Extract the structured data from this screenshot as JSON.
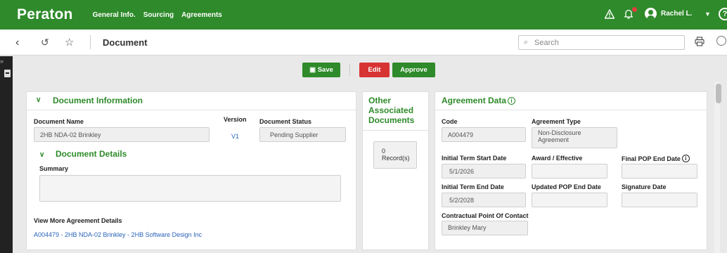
{
  "app": {
    "brand": "Peraton",
    "nav": [
      "General Info.",
      "Sourcing",
      "Agreements"
    ],
    "user_name": "Rachel L."
  },
  "subbar": {
    "page_title": "Document",
    "search_placeholder": "Search"
  },
  "actions": {
    "save": "Save",
    "edit": "Edit",
    "approve": "Approve"
  },
  "document_information": {
    "header": "Document Information",
    "name_label": "Document Name",
    "name_value": "2HB NDA-02 Brinkley",
    "version_label": "Version",
    "version_value": "V1",
    "status_label": "Document Status",
    "status_value": "Pending Supplier",
    "details_header": "Document Details",
    "summary_label": "Summary",
    "more_label": "View More Agreement Details",
    "more_link": "A004479 - 2HB NDA-02 Brinkley - 2HB Software Design Inc"
  },
  "other_documents": {
    "header_line1": "Other",
    "header_line2": "Associated",
    "header_line3": "Documents",
    "count": "0",
    "count_label": "Record(s)"
  },
  "agreement_data": {
    "header": "Agreement Data",
    "code_label": "Code",
    "code_value": "A004479",
    "type_label": "Agreement Type",
    "type_value_line1": "Non-Disclosure",
    "type_value_line2": "Agreement",
    "start_label": "Initial Term Start Date",
    "start_value": "5/1/2026",
    "award_label": "Award / Effective",
    "final_pop_label": "Final POP End Date",
    "end_label": "Initial Term End Date",
    "end_value": "5/2/2028",
    "updated_pop_label": "Updated POP End Date",
    "signature_label": "Signature Date",
    "contact_label": "Contractual Point Of Contact",
    "contact_value": "Brinkley Mary"
  },
  "colors": {
    "brand_green": "#2e8a2a",
    "edit_red": "#d83333",
    "link_blue": "#2a64b8"
  }
}
